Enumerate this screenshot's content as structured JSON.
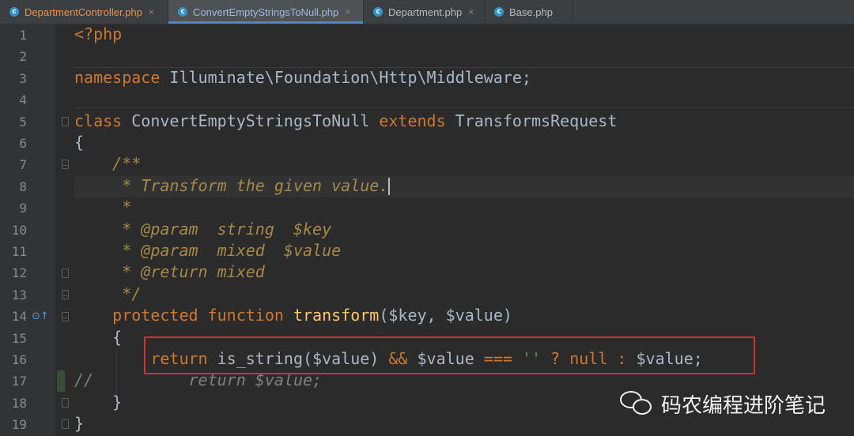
{
  "tabs": [
    {
      "label": "DepartmentController.php",
      "icon": "php-class-icon",
      "modified": true,
      "active": false
    },
    {
      "label": "ConvertEmptyStringsToNull.php",
      "icon": "php-class-icon",
      "modified": false,
      "active": true
    },
    {
      "label": "Department.php",
      "icon": "php-class-icon",
      "modified": false,
      "active": false
    },
    {
      "label": "Base.php",
      "icon": "php-class-icon",
      "modified": false,
      "active": false
    }
  ],
  "tab_icon_glyph": "c",
  "close_glyph": "×",
  "line_numbers": [
    "1",
    "2",
    "3",
    "4",
    "5",
    "6",
    "7",
    "8",
    "9",
    "10",
    "11",
    "12",
    "13",
    "14",
    "15",
    "16",
    "17",
    "18",
    "19"
  ],
  "code": {
    "l1_open": "<?php",
    "l3_kw": "namespace",
    "l3_ns": " Illuminate\\Foundation\\Http\\Middleware;",
    "l5_kw1": "class",
    "l5_name": " ConvertEmptyStringsToNull ",
    "l5_kw2": "extends",
    "l5_parent": " TransformsRequest",
    "l6": "{",
    "l7": "    /**",
    "l8": "     * Transform the given value.",
    "l9": "     *",
    "l10": "     * @param  string  $key",
    "l11": "     * @param  mixed  $value",
    "l12": "     * @return mixed",
    "l13": "     */",
    "l14_indent": "    ",
    "l14_kw1": "protected",
    "l14_kw2": " function",
    "l14_fn": " transform",
    "l14_args": "($key, $value)",
    "l15": "    {",
    "l16_indent": "        ",
    "l16_kw": "return",
    "l16_call": " is_string",
    "l16_a1": "($value) ",
    "l16_op1": "&&",
    "l16_a2": " $value ",
    "l16_op2": "===",
    "l16_sp": " ",
    "l16_str": "''",
    "l16_q": " ? ",
    "l16_null": "null",
    "l16_colon": " : ",
    "l16_end": "$value;",
    "l17_cmt": "//          return $value;",
    "l18": "    }",
    "l19": "}"
  },
  "watermark": {
    "icon": "wechat-icon",
    "text": "码农编程进阶笔记"
  },
  "colors": {
    "background": "#2b2b2b",
    "keyword": "#cc7832",
    "function": "#ffc66d",
    "doc_comment": "#a5894a",
    "string": "#6a8759",
    "highlight_box": "#d03232"
  }
}
